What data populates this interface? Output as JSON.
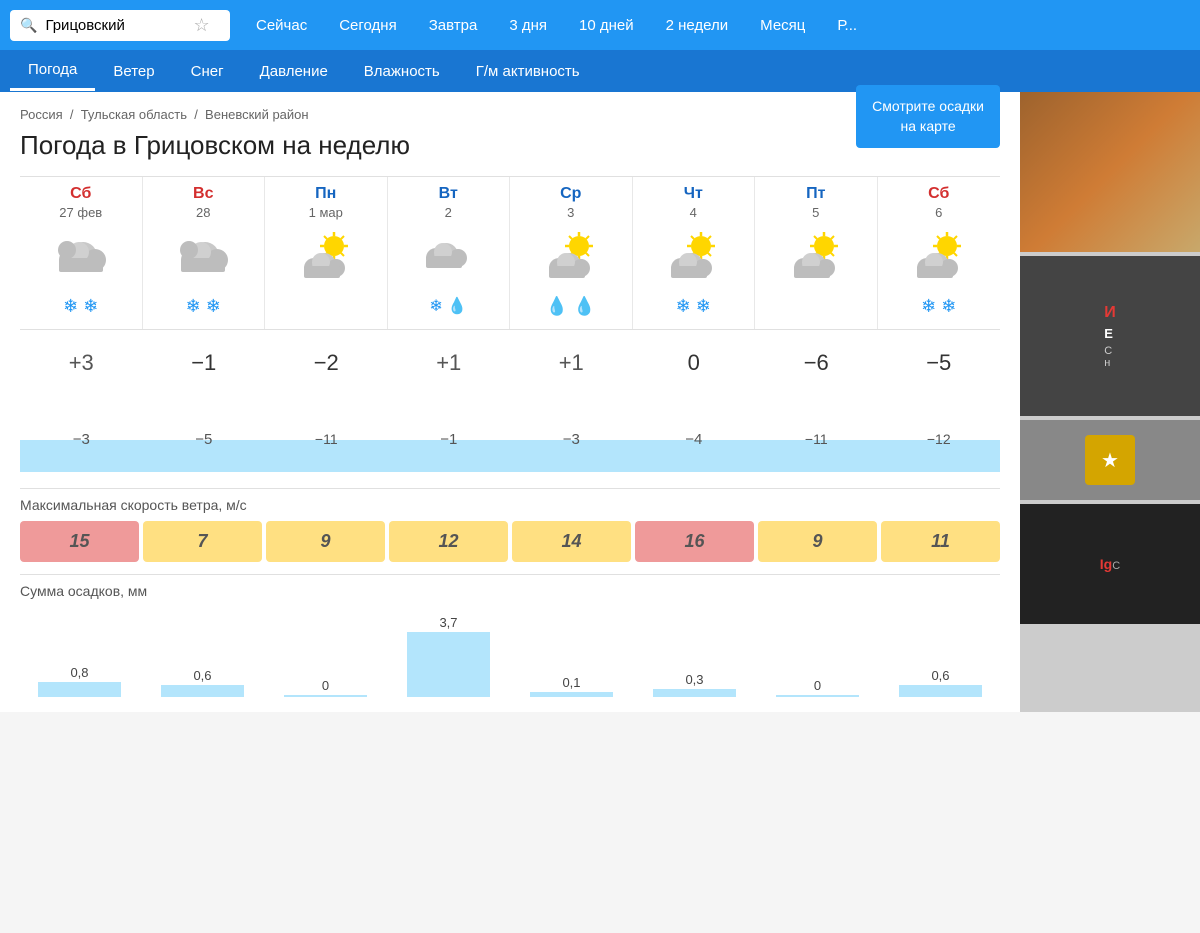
{
  "search": {
    "placeholder": "Грицовский",
    "value": "Грицовский"
  },
  "nav": {
    "links": [
      "Сейчас",
      "Сегодня",
      "Завтра",
      "3 дня",
      "10 дней",
      "2 недели",
      "Месяц",
      "Р..."
    ]
  },
  "secondary_nav": {
    "links": [
      "Погода",
      "Ветер",
      "Снег",
      "Давление",
      "Влажность",
      "Г/м активность"
    ]
  },
  "breadcrumb": {
    "items": [
      "Россия",
      "Тульская область",
      "Веневский район"
    ]
  },
  "page_title": "Погода в Грицовском на неделю",
  "map_button": "Смотрите осадки\nна карте",
  "days": [
    {
      "name": "Сб",
      "date": "27 фев",
      "type": "weekend",
      "icon": "cloudy",
      "precip": "snow2",
      "high": "+3",
      "low": "−3",
      "lower": null
    },
    {
      "name": "Вс",
      "date": "28",
      "type": "weekend",
      "icon": "cloudy",
      "precip": "snow2",
      "high": "−1",
      "low": "−5",
      "lower": null
    },
    {
      "name": "Пн",
      "date": "1 мар",
      "type": "weekday",
      "icon": "partly-cloudy",
      "precip": "none",
      "high": "−2",
      "low": null,
      "lower": "−11"
    },
    {
      "name": "Вт",
      "date": "2",
      "type": "weekday",
      "icon": "cloudy-rain",
      "precip": "rain-snow",
      "high": "+1",
      "low": "−1",
      "lower": null
    },
    {
      "name": "Ср",
      "date": "3",
      "type": "weekday",
      "icon": "partly-cloudy",
      "precip": "rain2",
      "high": "+1",
      "low": "−3",
      "lower": null
    },
    {
      "name": "Чт",
      "date": "4",
      "type": "weekday",
      "icon": "partly-cloudy",
      "precip": "snow2",
      "high": "0",
      "low": "−4",
      "lower": null
    },
    {
      "name": "Пт",
      "date": "5",
      "type": "weekday",
      "icon": "partly-cloudy",
      "precip": "none",
      "high": "−6",
      "low": null,
      "lower": "−11"
    },
    {
      "name": "Сб",
      "date": "6",
      "type": "weekend",
      "icon": "partly-cloudy",
      "precip": "snow2",
      "high": "−5",
      "low": null,
      "lower": "−12"
    }
  ],
  "temp_high": [
    "+3",
    "−1",
    "−2",
    "+1",
    "+1",
    "0",
    "−6",
    "−5"
  ],
  "temp_mid": [
    "−3",
    "−5",
    null,
    "−1",
    "−3",
    "−4",
    null,
    null
  ],
  "temp_low": [
    null,
    null,
    "−11",
    null,
    null,
    null,
    "−11",
    "−12"
  ],
  "wind_label": "Максимальная скорость ветра, м/с",
  "wind": [
    {
      "value": "15",
      "level": "high"
    },
    {
      "value": "7",
      "level": "low"
    },
    {
      "value": "9",
      "level": "low"
    },
    {
      "value": "12",
      "level": "low"
    },
    {
      "value": "14",
      "level": "low"
    },
    {
      "value": "16",
      "level": "high"
    },
    {
      "value": "9",
      "level": "low"
    },
    {
      "value": "11",
      "level": "low"
    }
  ],
  "precip_label": "Сумма осадков, мм",
  "precip": [
    {
      "value": "0,8",
      "height": 15
    },
    {
      "value": "0,6",
      "height": 12
    },
    {
      "value": "0",
      "height": 2
    },
    {
      "value": "3,7",
      "height": 65
    },
    {
      "value": "0,1",
      "height": 5
    },
    {
      "value": "0,3",
      "height": 8
    },
    {
      "value": "0",
      "height": 2
    },
    {
      "value": "0,6",
      "height": 12
    }
  ]
}
